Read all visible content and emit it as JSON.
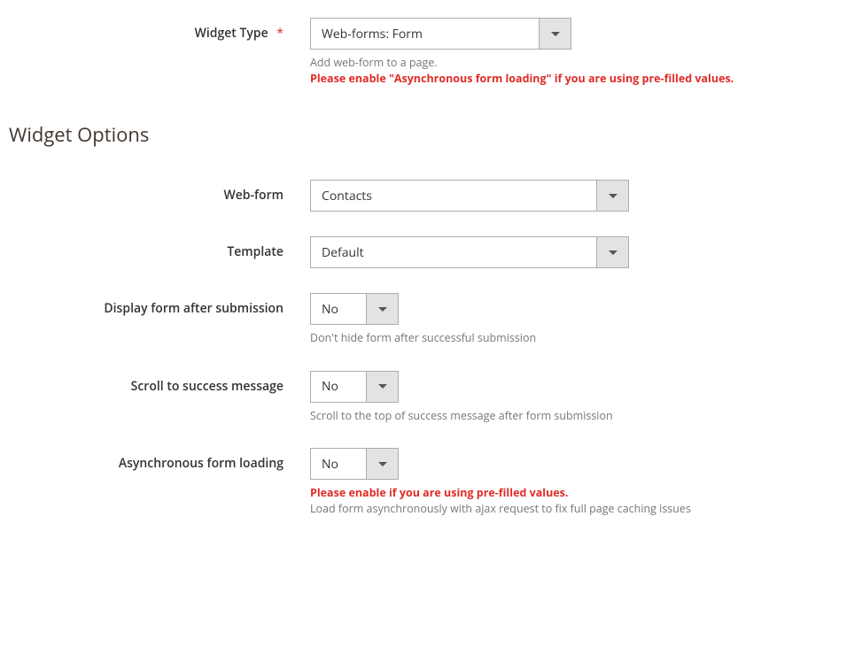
{
  "widgetType": {
    "label": "Widget Type",
    "required": "*",
    "value": "Web-forms: Form",
    "note1": "Add web-form to a page.",
    "note2": "Please enable \"Asynchronous form loading\" if you are using pre-filled values."
  },
  "sectionTitle": "Widget Options",
  "webform": {
    "label": "Web-form",
    "value": "Contacts"
  },
  "template": {
    "label": "Template",
    "value": "Default"
  },
  "displayAfter": {
    "label": "Display form after submission",
    "value": "No",
    "note": "Don't hide form after successful submission"
  },
  "scrollSuccess": {
    "label": "Scroll to success message",
    "value": "No",
    "note": "Scroll to the top of success message after form submission"
  },
  "asyncLoading": {
    "label": "Asynchronous form loading",
    "value": "No",
    "warn": "Please enable if you are using pre-filled values.",
    "note": "Load form asynchronously with ajax request to fix full page caching issues"
  }
}
